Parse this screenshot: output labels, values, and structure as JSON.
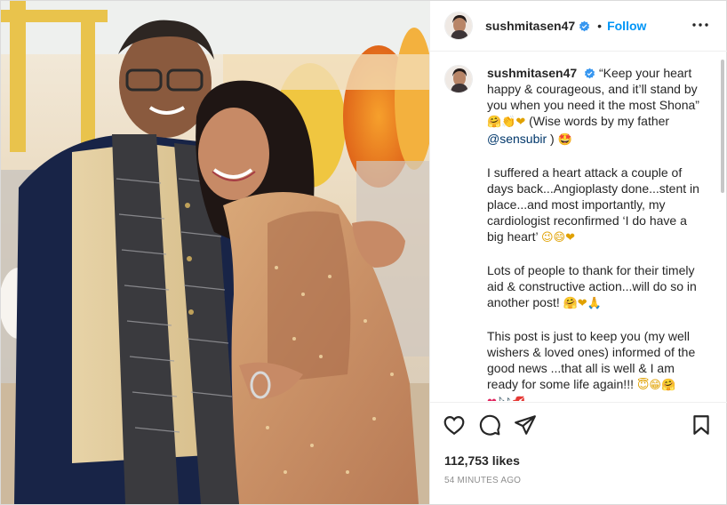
{
  "post": {
    "username": "sushmitasen47",
    "follow_label": "Follow",
    "dot": "•",
    "more_icon": "more-options-icon"
  },
  "caption": {
    "username": "sushmitasen47",
    "p1_text": "“Keep your heart happy & courageous, and it’ll stand by you when you need it the most Shona”",
    "p1_emoji": "🤗👏❤",
    "p1_paren_open": "(Wise words by my father",
    "mention": "@sensubir",
    "p1_paren_close": ")",
    "p1_end_emoji": "🤩",
    "p2_text": "I suffered a heart attack a couple of days back...Angioplasty done...stent in place...and most importantly, my cardiologist reconfirmed ‘I do have a big heart’",
    "p2_emoji": "😉😄❤",
    "p3_text": "Lots of people to thank for their timely aid & constructive action...will do so in another post!",
    "p3_emoji": "🤗❤🙏",
    "p4_text": "This post is just to keep you (my well wishers & loved ones) informed of the good news ...that all is well & I am ready for some life again!!!",
    "p4_emoji_a": "😇😁🤗",
    "p4_emoji_b": "❤🎶💋"
  },
  "actions": {
    "like_icon": "heart-icon",
    "comment_icon": "comment-icon",
    "share_icon": "share-icon",
    "save_icon": "bookmark-icon"
  },
  "stats": {
    "likes": "112,753 likes",
    "time_ago": "54 MINUTES AGO"
  },
  "colors": {
    "accent": "#0095f6",
    "verified": "#3897f0",
    "mention": "#00376b",
    "muted": "#8e8e8e"
  }
}
